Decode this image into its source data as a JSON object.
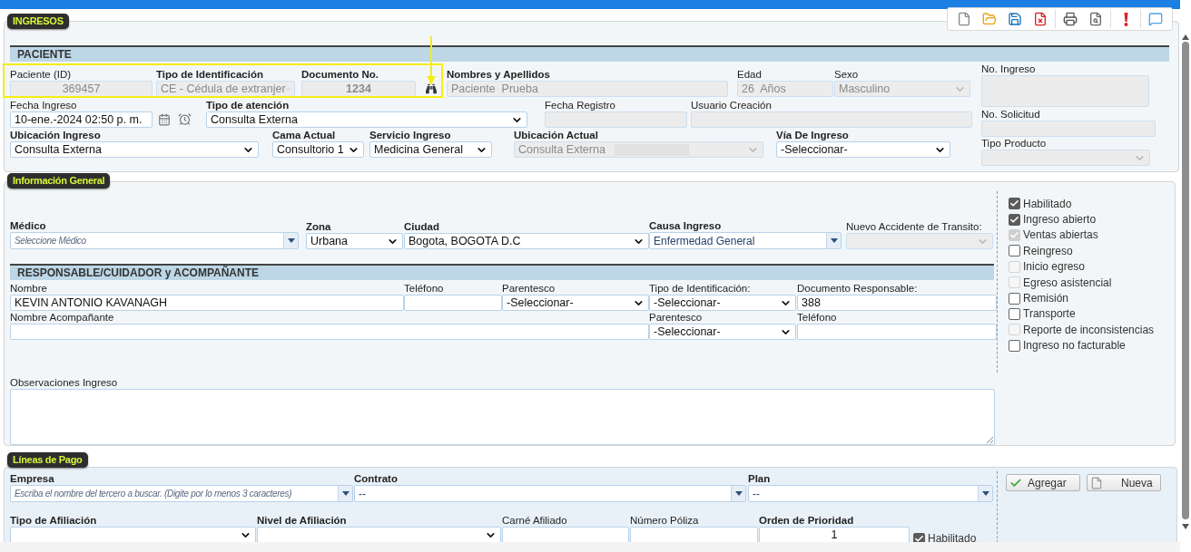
{
  "ingresos": {
    "legend": "INGRESOS",
    "section_title": "PACIENTE",
    "row_1": [
      {
        "label": "Paciente (ID)",
        "value": "369457",
        "kind": "text",
        "disabled": true,
        "required": false
      },
      {
        "label": "Tipo de Identificación",
        "value": "CE - Cédula de extranjer",
        "kind": "select",
        "disabled": true,
        "required": true
      },
      {
        "label": "Documento No.",
        "value": "1234",
        "kind": "text",
        "disabled": true,
        "required": true
      },
      {
        "label": "Nombres y Apellidos",
        "value": "Paciente  Prueba",
        "kind": "text",
        "disabled": true,
        "required": true
      },
      {
        "label": "Edad",
        "value": "26  Años",
        "kind": "text",
        "disabled": true,
        "required": false
      },
      {
        "label": "Sexo",
        "value": "Masculino",
        "kind": "select",
        "disabled": true,
        "required": false
      }
    ],
    "row_2": [
      {
        "label": "Fecha Ingreso",
        "value": "10-ene.-2024 02:50 p. m.",
        "kind": "text",
        "disabled": false,
        "required": false
      },
      {
        "label": "Tipo de atención",
        "value": "Consulta Externa",
        "kind": "select",
        "disabled": false,
        "required": true
      },
      {
        "label": "Fecha Registro",
        "kind": "text",
        "disabled": true,
        "required": false
      },
      {
        "label": "Usuario Creación",
        "kind": "text",
        "disabled": true,
        "required": false
      }
    ],
    "row_3": [
      {
        "label": "Ubicación Ingreso",
        "value": "Consulta Externa",
        "kind": "select",
        "disabled": false,
        "required": true
      },
      {
        "label": "Cama Actual",
        "value": "Consultorio 1",
        "kind": "select",
        "disabled": false,
        "required": true
      },
      {
        "label": "Servicio Ingreso",
        "value": "Medicina General",
        "kind": "select",
        "disabled": false,
        "required": true
      },
      {
        "label": "Ubicación Actual",
        "value": "Consulta Externa",
        "kind": "select",
        "disabled": true,
        "required": true
      },
      {
        "label": "Vía De Ingreso",
        "value": "-Seleccionar-",
        "kind": "select",
        "disabled": false,
        "required": true
      }
    ],
    "side": [
      {
        "label": "No. Ingreso",
        "kind": "text",
        "disabled": true,
        "required": false
      },
      {
        "label": "No. Solicitud",
        "kind": "text",
        "disabled": true,
        "required": false
      },
      {
        "label": "Tipo Producto",
        "kind": "select",
        "disabled": true,
        "required": false
      }
    ]
  },
  "informacion_general": {
    "legend": "Información General",
    "row_1": [
      {
        "label": "Médico",
        "placeholder": "Seleccione Médico",
        "kind": "combo",
        "disabled": false,
        "required": true
      },
      {
        "label": "Zona",
        "value": "Urbana",
        "kind": "select",
        "disabled": false,
        "required": true
      },
      {
        "label": "Ciudad",
        "value": "Bogota, BOGOTA D.C",
        "kind": "select",
        "disabled": false,
        "required": true
      },
      {
        "label": "Causa Ingreso",
        "value": "Enfermedad General",
        "kind": "combo",
        "disabled": false,
        "required": true
      },
      {
        "label": "Nuevo Accidente de Transito:",
        "kind": "select",
        "disabled": true,
        "required": false
      }
    ],
    "responsable": {
      "title": "RESPONSABLE/CUIDADOR y ACOMPAÑANTE",
      "row_1": [
        {
          "label": "Nombre",
          "value": "KEVIN ANTONIO KAVANAGH",
          "kind": "text",
          "disabled": false,
          "required": false
        },
        {
          "label": "Teléfono",
          "kind": "text",
          "disabled": false,
          "required": false
        },
        {
          "label": "Parentesco",
          "value": "-Seleccionar-",
          "kind": "select",
          "disabled": false,
          "required": false
        },
        {
          "label": "Tipo de Identificación:",
          "value": "-Seleccionar-",
          "kind": "select",
          "disabled": false,
          "required": false
        },
        {
          "label": "Documento Responsable:",
          "value": "388",
          "kind": "text",
          "disabled": false,
          "required": false
        }
      ],
      "row_2": [
        {
          "label": "Nombre Acompañante",
          "kind": "text",
          "disabled": false,
          "required": false
        },
        {
          "label": "Parentesco",
          "value": "-Seleccionar-",
          "kind": "select",
          "disabled": false,
          "required": false
        },
        {
          "label": "Teléfono",
          "kind": "text",
          "disabled": false,
          "required": false
        }
      ]
    },
    "observaciones": {
      "label": "Observaciones Ingreso",
      "kind": "textarea",
      "disabled": false,
      "required": false
    },
    "options": [
      {
        "label": "Habilitado",
        "checked": true,
        "disabled": false
      },
      {
        "label": "Ingreso abierto",
        "checked": true,
        "disabled": false
      },
      {
        "label": "Ventas abiertas",
        "checked": true,
        "disabled": true
      },
      {
        "label": "Reingreso",
        "checked": false,
        "disabled": false
      },
      {
        "label": "Inicio egreso",
        "checked": false,
        "disabled": true
      },
      {
        "label": "Egreso asistencial",
        "checked": false,
        "disabled": true
      },
      {
        "label": "Remisión",
        "checked": false,
        "disabled": false
      },
      {
        "label": "Transporte",
        "checked": false,
        "disabled": false
      },
      {
        "label": "Reporte de inconsistencias",
        "checked": false,
        "disabled": true
      },
      {
        "label": "Ingreso no facturable",
        "checked": false,
        "disabled": false
      }
    ]
  },
  "lineas_de_pago": {
    "legend": "Líneas de Pago",
    "row_1": [
      {
        "label": "Empresa",
        "placeholder": "Escriba el nombre del tercero a buscar. (Digite por lo menos 3 caracteres)",
        "kind": "combo",
        "disabled": false,
        "required": true
      },
      {
        "label": "Contrato",
        "value": "--",
        "kind": "combo",
        "disabled": false,
        "required": true
      },
      {
        "label": "Plan",
        "value": "--",
        "kind": "combo",
        "disabled": false,
        "required": true
      }
    ],
    "row_2": [
      {
        "label": "Tipo de Afiliación",
        "kind": "select",
        "disabled": false,
        "required": true
      },
      {
        "label": "Nivel de Afiliación",
        "kind": "select",
        "disabled": false,
        "required": true
      },
      {
        "label": "Carné Afiliado",
        "kind": "text",
        "disabled": false,
        "required": false
      },
      {
        "label": "Número Póliza",
        "kind": "text",
        "disabled": false,
        "required": false
      },
      {
        "label": "Orden de Prioridad",
        "value": "1",
        "kind": "text",
        "disabled": false,
        "required": true
      }
    ],
    "habilitado": {
      "label": "Habilitado",
      "checked": true,
      "disabled": false
    },
    "buttons": [
      {
        "label": "Agregar",
        "kind": "add"
      },
      {
        "label": "Nueva",
        "kind": "new"
      }
    ]
  }
}
